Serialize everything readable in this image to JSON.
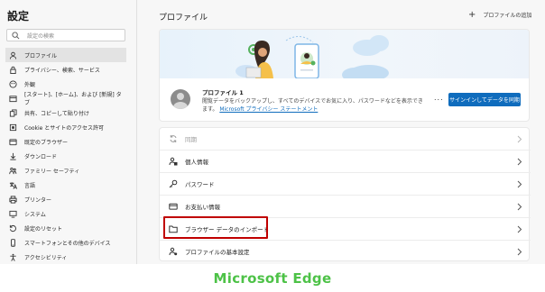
{
  "sidebar": {
    "title": "設定",
    "search_placeholder": "設定の検索",
    "items": [
      {
        "label": "プロファイル",
        "icon": "profile-icon",
        "active": true
      },
      {
        "label": "プライバシー、検索、サービス",
        "icon": "lock-icon"
      },
      {
        "label": "外観",
        "icon": "appearance-icon"
      },
      {
        "label": "[スタート]、[ホーム]、および [新規] タブ",
        "icon": "tabs-icon"
      },
      {
        "label": "共有、コピーして貼り付け",
        "icon": "share-icon"
      },
      {
        "label": "Cookie とサイトのアクセス許可",
        "icon": "cookie-icon"
      },
      {
        "label": "既定のブラウザー",
        "icon": "browser-icon"
      },
      {
        "label": "ダウンロード",
        "icon": "download-icon"
      },
      {
        "label": "ファミリー セーフティ",
        "icon": "family-icon"
      },
      {
        "label": "言語",
        "icon": "language-icon"
      },
      {
        "label": "プリンター",
        "icon": "printer-icon"
      },
      {
        "label": "システム",
        "icon": "system-icon"
      },
      {
        "label": "設定のリセット",
        "icon": "reset-icon"
      },
      {
        "label": "スマートフォンとその他のデバイス",
        "icon": "phone-icon"
      },
      {
        "label": "アクセシビリティ",
        "icon": "accessibility-icon"
      }
    ]
  },
  "main": {
    "title": "プロファイル",
    "add_profile": "プロファイルの追加",
    "profile": {
      "name": "プロファイル 1",
      "description": "閲覧データをバックアップし、すべてのデバイスでお気に入り、パスワードなどを表示できます。",
      "link": "Microsoft プライバシー ステートメント",
      "sync_button": "サインインしてデータを同期",
      "more": "..."
    },
    "rows": [
      {
        "label": "同期",
        "icon": "sync-icon",
        "disabled": true
      },
      {
        "label": "個人情報",
        "icon": "personal-info-icon"
      },
      {
        "label": "パスワード",
        "icon": "key-icon"
      },
      {
        "label": "お支払い情報",
        "icon": "card-icon"
      },
      {
        "label": "ブラウザー データのインポート",
        "icon": "folder-import-icon"
      },
      {
        "label": "プロファイルの基本設定",
        "icon": "profile-settings-icon"
      }
    ]
  },
  "caption": "Microsoft Edge",
  "colors": {
    "accent": "#0f6cbd",
    "highlight": "#c00000",
    "caption": "#4dc247"
  }
}
